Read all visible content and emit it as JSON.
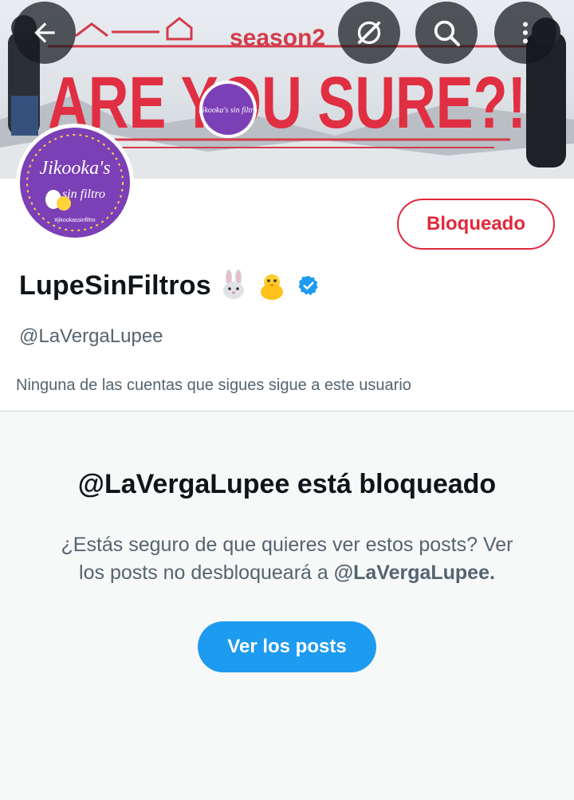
{
  "banner": {
    "season_text": "season2",
    "headline": "ARE YOU SURE?!",
    "badge_text": "Jikooka's sin filtro"
  },
  "top_bar": {
    "back_icon": "arrow-left-icon",
    "grok_icon": "grok-icon",
    "search_icon": "search-icon",
    "more_icon": "more-vertical-icon"
  },
  "avatar": {
    "title": "Jikooka's",
    "subtitle": "sin filtro",
    "hashtag": "#jikookassinfiltro"
  },
  "profile": {
    "blocked_button": "Bloqueado",
    "display_name": "LupeSinFiltros",
    "handle": "@LaVergaLupee",
    "followers_note": "Ninguna de las cuentas que sigues sigue a este usuario",
    "verified_color": "#1d9bf0"
  },
  "blocked_notice": {
    "title": "@LaVergaLupee está bloqueado",
    "description": "¿Estás seguro de que quieres ver estos posts? Ver los posts no desbloqueará a ",
    "description_handle": "@LaVergaLupee.",
    "view_button": "Ver los posts"
  },
  "colors": {
    "accent_blue": "#1d9bf0",
    "blocked_red": "#e0283b",
    "secondary_text": "#536471"
  }
}
